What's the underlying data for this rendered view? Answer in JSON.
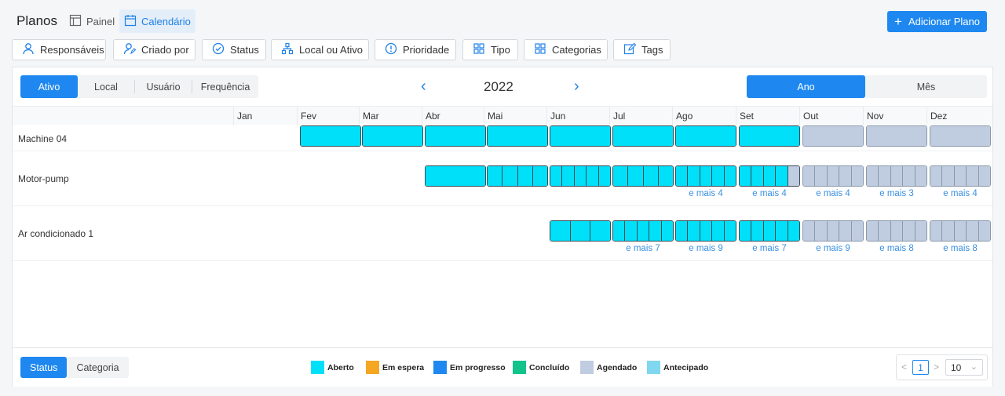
{
  "header": {
    "title": "Planos",
    "views": [
      {
        "label": "Painel",
        "icon": "layout-icon",
        "active": false
      },
      {
        "label": "Calendário",
        "icon": "calendar-icon",
        "active": true
      }
    ],
    "add_button": {
      "label": "Adicionar Plano",
      "icon": "plus-icon"
    }
  },
  "filters": [
    {
      "label": "Responsáveis",
      "icon": "user-icon"
    },
    {
      "label": "Criado por",
      "icon": "user-edit-icon"
    },
    {
      "label": "Status",
      "icon": "check-circle-icon"
    },
    {
      "label": "Local ou Ativo",
      "icon": "hierarchy-icon"
    },
    {
      "label": "Prioridade",
      "icon": "exclamation-circle-icon"
    },
    {
      "label": "Tipo",
      "icon": "grid-icon"
    },
    {
      "label": "Categorias",
      "icon": "grid-icon"
    },
    {
      "label": "Tags",
      "icon": "edit-icon"
    }
  ],
  "group_by": {
    "options": [
      "Ativo",
      "Local",
      "Usuário",
      "Frequência"
    ],
    "selected": "Ativo"
  },
  "year_nav": {
    "year": "2022",
    "prev": "‹",
    "next": "›"
  },
  "scale": {
    "options": [
      "Ano",
      "Mês"
    ],
    "selected": "Ano"
  },
  "months": [
    "Jan",
    "Fev",
    "Mar",
    "Abr",
    "Mai",
    "Jun",
    "Jul",
    "Ago",
    "Set",
    "Out",
    "Nov",
    "Dez"
  ],
  "rows": [
    {
      "label": "Machine 04",
      "cells": [
        {
          "month": 1,
          "status": "aberto",
          "count": 1
        },
        {
          "month": 2,
          "status": "aberto",
          "count": 1
        },
        {
          "month": 3,
          "status": "aberto",
          "count": 1
        },
        {
          "month": 4,
          "status": "aberto",
          "count": 1
        },
        {
          "month": 5,
          "status": "aberto",
          "count": 1
        },
        {
          "month": 6,
          "status": "aberto",
          "count": 1
        },
        {
          "month": 7,
          "status": "aberto",
          "count": 1
        },
        {
          "month": 8,
          "status": "aberto",
          "count": 1
        },
        {
          "month": 9,
          "status": "agendado",
          "count": 1
        },
        {
          "month": 10,
          "status": "agendado",
          "count": 1
        },
        {
          "month": 11,
          "status": "agendado",
          "count": 1
        }
      ]
    },
    {
      "label": "Motor-pump",
      "cells": [
        {
          "month": 3,
          "status": "aberto",
          "count": 1
        },
        {
          "month": 4,
          "status": "aberto",
          "count": 4
        },
        {
          "month": 5,
          "status": "aberto",
          "count": 5
        },
        {
          "month": 6,
          "status": "aberto",
          "count": 4
        },
        {
          "month": 7,
          "status": "aberto",
          "count": 5,
          "more": "e mais 4"
        },
        {
          "month": 8,
          "status": "mixed",
          "count": 5,
          "open": 4,
          "more": "e mais 4"
        },
        {
          "month": 9,
          "status": "agendado",
          "count": 5,
          "more": "e mais 4"
        },
        {
          "month": 10,
          "status": "agendado",
          "count": 5,
          "more": "e mais 3"
        },
        {
          "month": 11,
          "status": "agendado",
          "count": 5,
          "more": "e mais 4"
        }
      ]
    },
    {
      "label": "Ar condicionado 1",
      "cells": [
        {
          "month": 5,
          "status": "aberto",
          "count": 3
        },
        {
          "month": 6,
          "status": "aberto",
          "count": 5,
          "more": "e mais 7"
        },
        {
          "month": 7,
          "status": "aberto",
          "count": 5,
          "more": "e mais 9"
        },
        {
          "month": 8,
          "status": "aberto",
          "count": 5,
          "more": "e mais 7"
        },
        {
          "month": 9,
          "status": "agendado",
          "count": 5,
          "more": "e mais 9"
        },
        {
          "month": 10,
          "status": "agendado",
          "count": 5,
          "more": "e mais 8"
        },
        {
          "month": 11,
          "status": "agendado",
          "count": 5,
          "more": "e mais 8"
        }
      ]
    }
  ],
  "footer": {
    "legend_by": {
      "options": [
        "Status",
        "Categoria"
      ],
      "selected": "Status"
    },
    "legend": [
      {
        "label": "Aberto",
        "color": "#00e0f8"
      },
      {
        "label": "Em espera",
        "color": "#f5a623"
      },
      {
        "label": "Em progresso",
        "color": "#1e88f0"
      },
      {
        "label": "Concluído",
        "color": "#12c48b"
      },
      {
        "label": "Agendado",
        "color": "#c0cce0"
      },
      {
        "label": "Antecipado",
        "color": "#7fd8ef"
      }
    ],
    "pagination": {
      "page": "1",
      "page_size": "10",
      "prev": "<",
      "next": ">"
    }
  },
  "colors": {
    "accent": "#1e88f0",
    "aberto": "#00e0f8",
    "agendado": "#c0cce0",
    "link": "#3a8fe0"
  }
}
